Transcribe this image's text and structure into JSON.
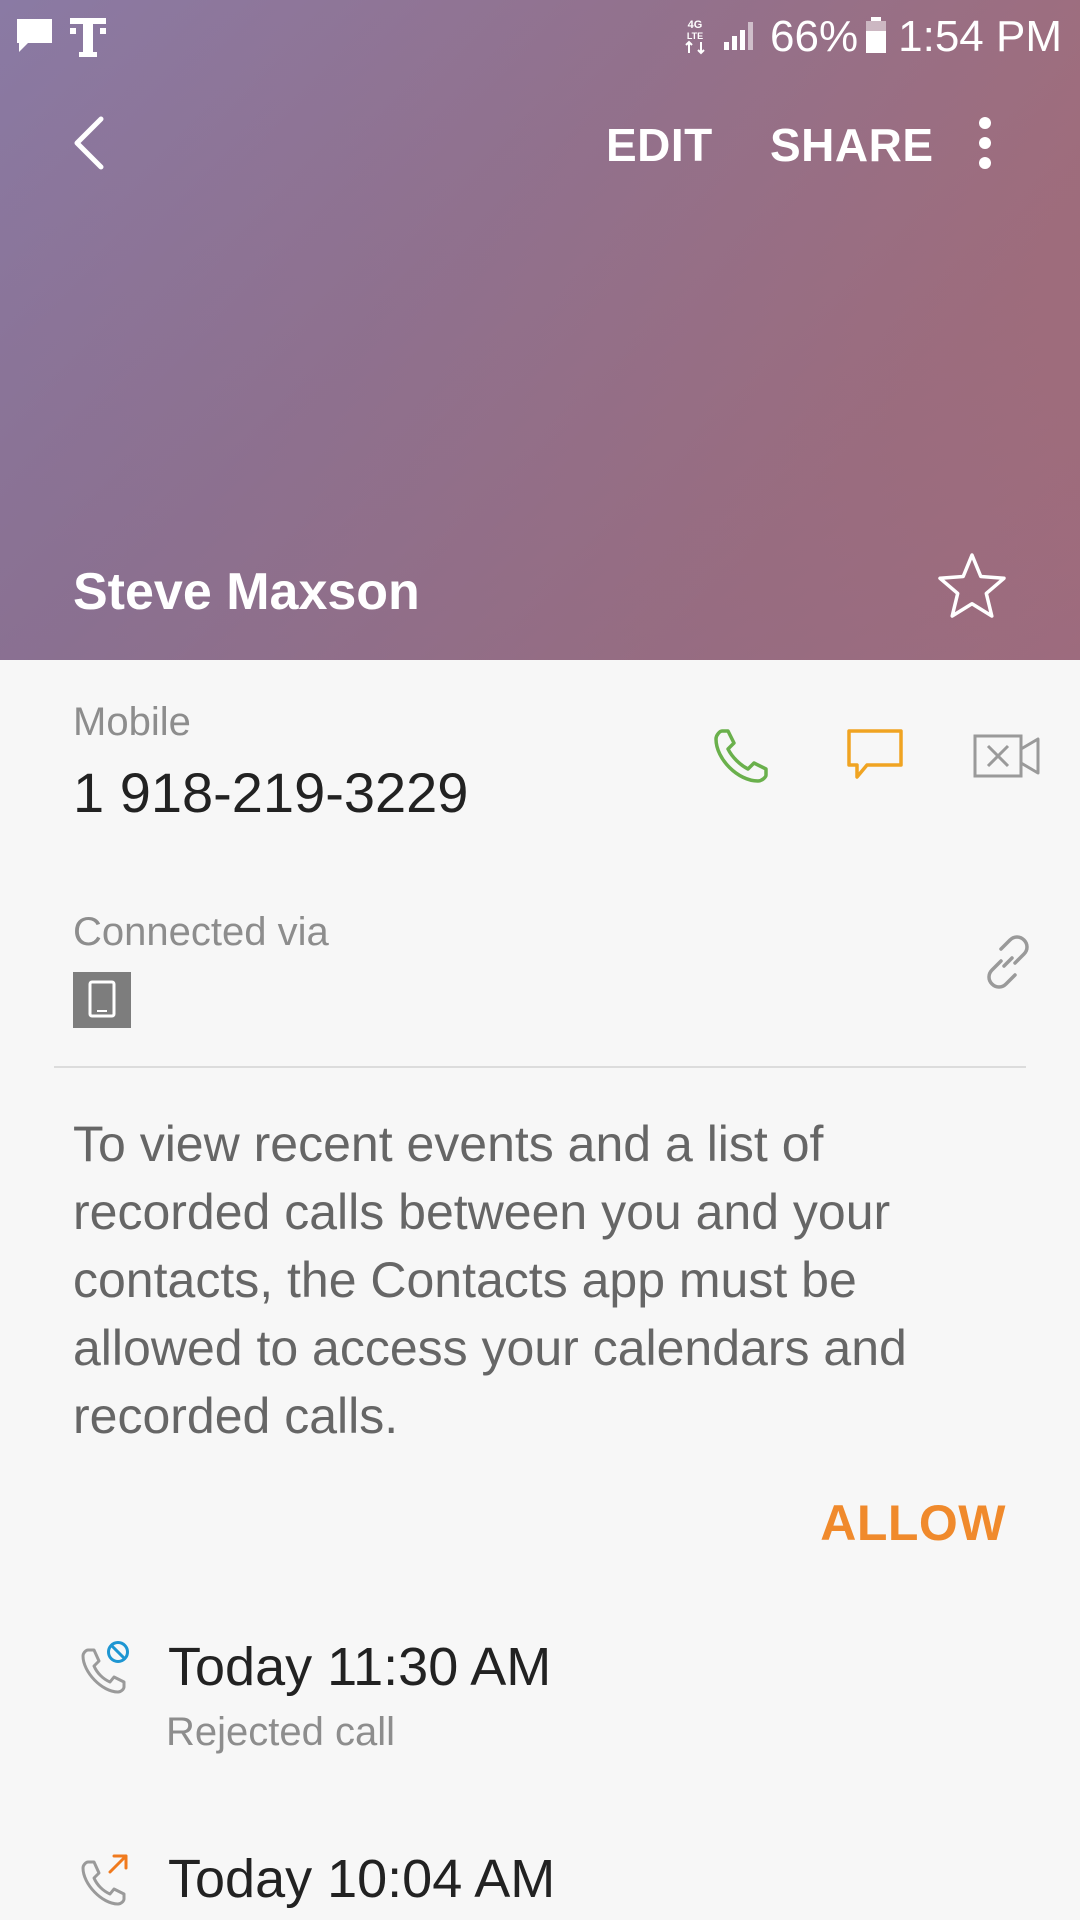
{
  "status_bar": {
    "battery": "66%",
    "time": "1:54 PM"
  },
  "toolbar": {
    "edit_label": "EDIT",
    "share_label": "SHARE"
  },
  "contact": {
    "name": "Steve Maxson"
  },
  "phone": {
    "label": "Mobile",
    "number": "1 918-219-3229"
  },
  "connected": {
    "label": "Connected via"
  },
  "permission": {
    "message": "To view recent events and a list of recorded calls between you and your contacts, the Contacts app must be allowed to access your calendars and recorded calls.",
    "allow_label": "ALLOW"
  },
  "call_log": [
    {
      "time": "Today 11:30 AM",
      "status": "Rejected call",
      "icon": "rejected-call-icon"
    },
    {
      "time": "Today 10:04 AM",
      "status": "",
      "icon": "outgoing-call-icon"
    }
  ],
  "colors": {
    "call_green": "#6ab04c",
    "message_orange": "#f0a422",
    "allow_orange": "#f08a2c",
    "rejected_blue": "#1e96d2",
    "outgoing_orange": "#f07a1e"
  }
}
